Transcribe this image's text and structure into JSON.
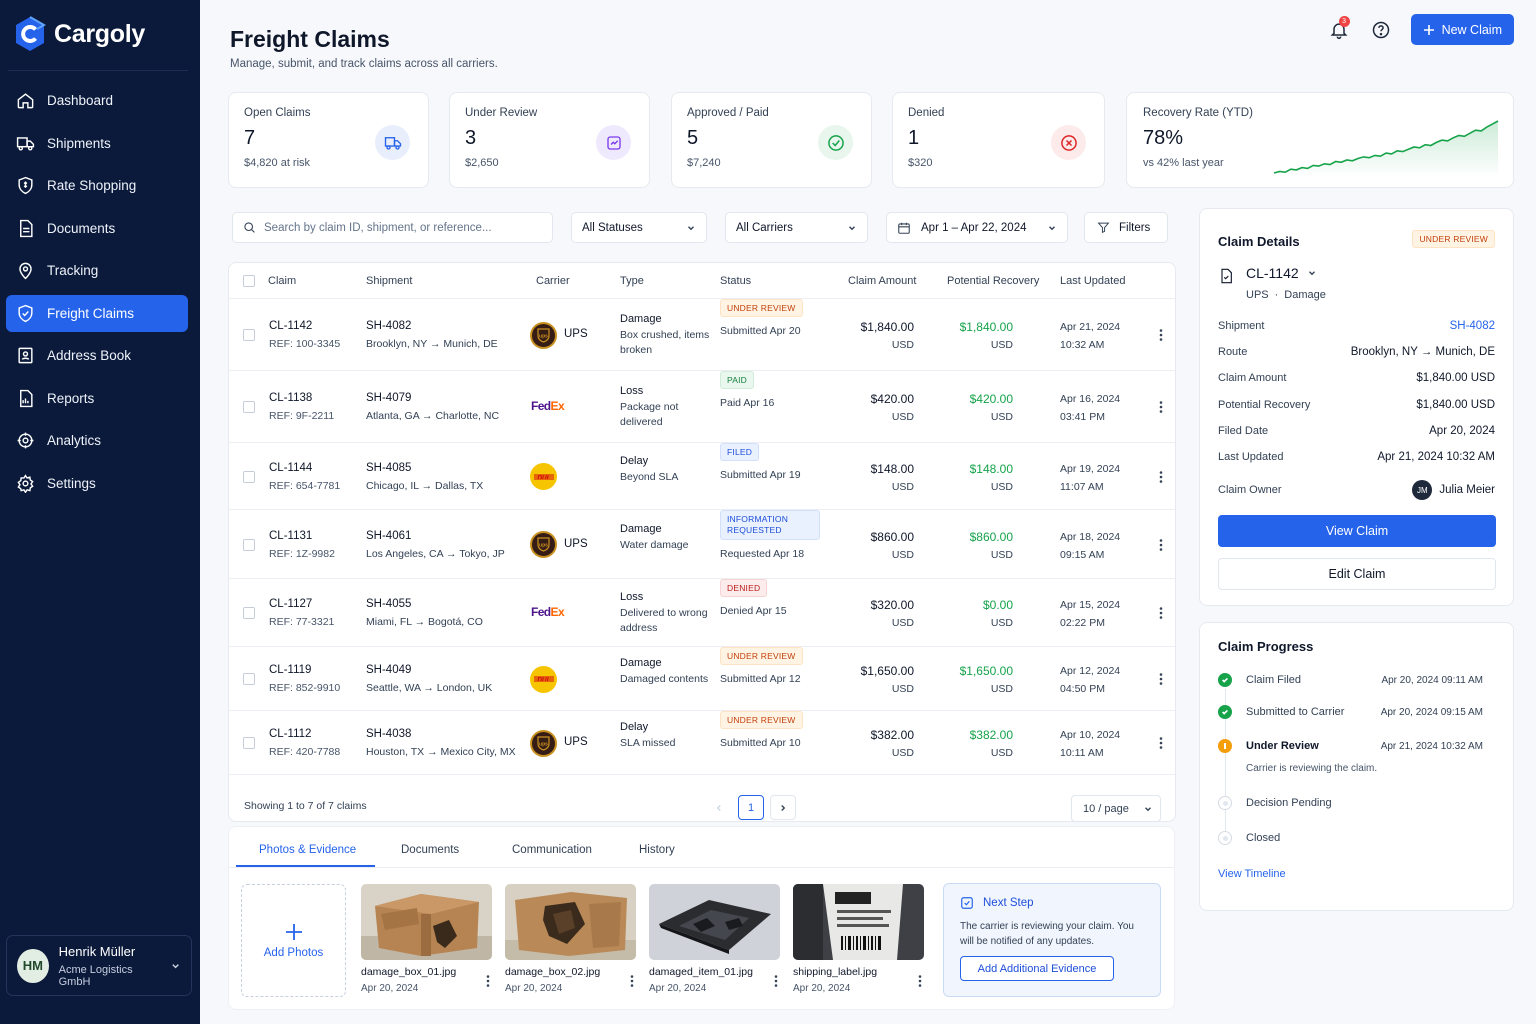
{
  "app": {
    "name": "Cargoly"
  },
  "sidebar": {
    "items": [
      {
        "label": "Dashboard",
        "icon": "home-icon"
      },
      {
        "label": "Shipments",
        "icon": "truck-icon"
      },
      {
        "label": "Rate Shopping",
        "icon": "tag-shield-icon"
      },
      {
        "label": "Documents",
        "icon": "document-icon"
      },
      {
        "label": "Tracking",
        "icon": "location-pin-icon"
      },
      {
        "label": "Freight Claims",
        "icon": "shield-check-icon",
        "active": true
      },
      {
        "label": "Address Book",
        "icon": "address-book-icon"
      },
      {
        "label": "Reports",
        "icon": "reports-icon"
      },
      {
        "label": "Analytics",
        "icon": "analytics-icon"
      },
      {
        "label": "Settings",
        "icon": "gear-icon"
      }
    ],
    "user": {
      "initials": "HM",
      "name": "Henrik Müller",
      "company": "Acme Logistics GmbH"
    }
  },
  "header": {
    "title": "Freight Claims",
    "subtitle": "Manage, submit, and track claims across all carriers.",
    "notifications": "3",
    "new_claim": "New Claim"
  },
  "stats": [
    {
      "label": "Open Claims",
      "value": "7",
      "sub": "$4,820 at risk",
      "icon": "truck-icon",
      "color": "#2563eb"
    },
    {
      "label": "Under Review",
      "value": "3",
      "sub": "$2,650",
      "icon": "review-icon",
      "color": "#7c3aed"
    },
    {
      "label": "Approved / Paid",
      "value": "5",
      "sub": "$7,240",
      "icon": "check-circle-icon",
      "color": "#16a34a"
    },
    {
      "label": "Denied",
      "value": "1",
      "sub": "$320",
      "icon": "x-circle-icon",
      "color": "#dc2626"
    }
  ],
  "recovery": {
    "label": "Recovery Rate (YTD)",
    "value": "78%",
    "sub": "vs 42% last year",
    "trend": [
      12,
      14,
      13,
      17,
      16,
      19,
      18,
      22,
      21,
      24,
      23,
      27,
      26,
      29,
      28,
      31,
      33,
      32,
      35,
      34,
      38,
      37,
      41,
      40,
      43,
      46,
      45,
      49,
      48,
      52,
      55,
      54,
      58,
      61,
      60,
      64,
      68,
      67,
      72,
      76,
      80
    ]
  },
  "filters": {
    "search_placeholder": "Search by claim ID, shipment, or reference...",
    "status": "All Statuses",
    "carrier": "All Carriers",
    "date_range": "Apr 1 – Apr 22, 2024",
    "filters": "Filters"
  },
  "table": {
    "columns": [
      "Claim",
      "Shipment",
      "Carrier",
      "Type",
      "Status",
      "Claim Amount",
      "Potential Recovery",
      "Last Updated"
    ],
    "rows": [
      {
        "claim": "CL-1142",
        "ref": "REF: 100-3345",
        "shipment": "SH-4082",
        "route": "Brooklyn, NY → Munich, DE",
        "carrier": "UPS",
        "type": "Damage",
        "type_desc": "Box crushed, items broken",
        "status": "UNDER REVIEW",
        "status_kind": "review",
        "status_sub": "Submitted Apr 20",
        "amount": "$1,840.00",
        "recovery": "$1,840.00",
        "currency": "USD",
        "updated_date": "Apr 21, 2024",
        "updated_time": "10:32 AM"
      },
      {
        "claim": "CL-1138",
        "ref": "REF: 9F-2211",
        "shipment": "SH-4079",
        "route": "Atlanta, GA → Charlotte, NC",
        "carrier": "FedEx",
        "type": "Loss",
        "type_desc": "Package not delivered",
        "status": "PAID",
        "status_kind": "paid",
        "status_sub": "Paid Apr 16",
        "amount": "$420.00",
        "recovery": "$420.00",
        "currency": "USD",
        "updated_date": "Apr 16, 2024",
        "updated_time": "03:41 PM"
      },
      {
        "claim": "CL-1144",
        "ref": "REF: 654-7781",
        "shipment": "SH-4085",
        "route": "Chicago, IL → Dallas, TX",
        "carrier": "DHL",
        "type": "Delay",
        "type_desc": "Beyond SLA",
        "status": "FILED",
        "status_kind": "filed",
        "status_sub": "Submitted Apr 19",
        "amount": "$148.00",
        "recovery": "$148.00",
        "currency": "USD",
        "updated_date": "Apr 19, 2024",
        "updated_time": "11:07 AM"
      },
      {
        "claim": "CL-1131",
        "ref": "REF: 1Z-9982",
        "shipment": "SH-4061",
        "route": "Los Angeles, CA → Tokyo, JP",
        "carrier": "UPS",
        "type": "Damage",
        "type_desc": "Water damage",
        "status": "INFORMATION REQUESTED",
        "status_kind": "info",
        "status_sub": "Requested Apr 18",
        "amount": "$860.00",
        "recovery": "$860.00",
        "currency": "USD",
        "updated_date": "Apr 18, 2024",
        "updated_time": "09:15 AM"
      },
      {
        "claim": "CL-1127",
        "ref": "REF: 77-3321",
        "shipment": "SH-4055",
        "route": "Miami, FL → Bogotá, CO",
        "carrier": "FedEx",
        "type": "Loss",
        "type_desc": "Delivered to wrong address",
        "status": "DENIED",
        "status_kind": "denied",
        "status_sub": "Denied Apr 15",
        "amount": "$320.00",
        "recovery": "$0.00",
        "currency": "USD",
        "updated_date": "Apr 15, 2024",
        "updated_time": "02:22 PM"
      },
      {
        "claim": "CL-1119",
        "ref": "REF: 852-9910",
        "shipment": "SH-4049",
        "route": "Seattle, WA → London, UK",
        "carrier": "DHL",
        "type": "Damage",
        "type_desc": "Damaged contents",
        "status": "UNDER REVIEW",
        "status_kind": "review",
        "status_sub": "Submitted Apr 12",
        "amount": "$1,650.00",
        "recovery": "$1,650.00",
        "currency": "USD",
        "updated_date": "Apr 12, 2024",
        "updated_time": "04:50 PM"
      },
      {
        "claim": "CL-1112",
        "ref": "REF: 420-7788",
        "shipment": "SH-4038",
        "route": "Houston, TX → Mexico City, MX",
        "carrier": "UPS",
        "type": "Delay",
        "type_desc": "SLA missed",
        "status": "UNDER REVIEW",
        "status_kind": "review",
        "status_sub": "Submitted Apr 10",
        "amount": "$382.00",
        "recovery": "$382.00",
        "currency": "USD",
        "updated_date": "Apr 10, 2024",
        "updated_time": "10:11 AM"
      }
    ],
    "footer": "Showing 1 to 7 of 7 claims",
    "page": "1",
    "per_page": "10 / page"
  },
  "tabs": [
    "Photos & Evidence",
    "Documents",
    "Communication",
    "History"
  ],
  "photos": {
    "add_label": "Add Photos",
    "items": [
      {
        "name": "damage_box_01.jpg",
        "date": "Apr 20, 2024"
      },
      {
        "name": "damage_box_02.jpg",
        "date": "Apr 20, 2024"
      },
      {
        "name": "damaged_item_01.jpg",
        "date": "Apr 20, 2024"
      },
      {
        "name": "shipping_label.jpg",
        "date": "Apr 20, 2024"
      }
    ]
  },
  "next_step": {
    "title": "Next Step",
    "text": "The carrier is reviewing your claim. You will be notified of any updates.",
    "button": "Add Additional Evidence"
  },
  "details": {
    "title": "Claim Details",
    "status": "UNDER REVIEW",
    "claim_id": "CL-1142",
    "carrier": "UPS",
    "type": "Damage",
    "dot": "·",
    "fields": [
      {
        "label": "Shipment",
        "value": "SH-4082",
        "link": true
      },
      {
        "label": "Route",
        "value": "Brooklyn, NY → Munich, DE"
      },
      {
        "label": "Claim Amount",
        "value": "$1,840.00 USD"
      },
      {
        "label": "Potential Recovery",
        "value": "$1,840.00 USD"
      },
      {
        "label": "Filed Date",
        "value": "Apr 20, 2024"
      },
      {
        "label": "Last Updated",
        "value": "Apr 21, 2024 10:32 AM"
      }
    ],
    "owner_label": "Claim Owner",
    "owner_initials": "JM",
    "owner": "Julia Meier",
    "view": "View Claim",
    "edit": "Edit Claim"
  },
  "progress": {
    "title": "Claim Progress",
    "steps": [
      {
        "label": "Claim Filed",
        "time": "Apr 20, 2024 09:11 AM",
        "state": "done"
      },
      {
        "label": "Submitted to Carrier",
        "time": "Apr 20, 2024 09:15 AM",
        "state": "done"
      },
      {
        "label": "Under Review",
        "time": "Apr 21, 2024 10:32 AM",
        "state": "current",
        "note": "Carrier is reviewing the claim."
      },
      {
        "label": "Decision Pending",
        "time": "",
        "state": "pending"
      },
      {
        "label": "Closed",
        "time": "",
        "state": "pending"
      }
    ],
    "link": "View Timeline"
  }
}
